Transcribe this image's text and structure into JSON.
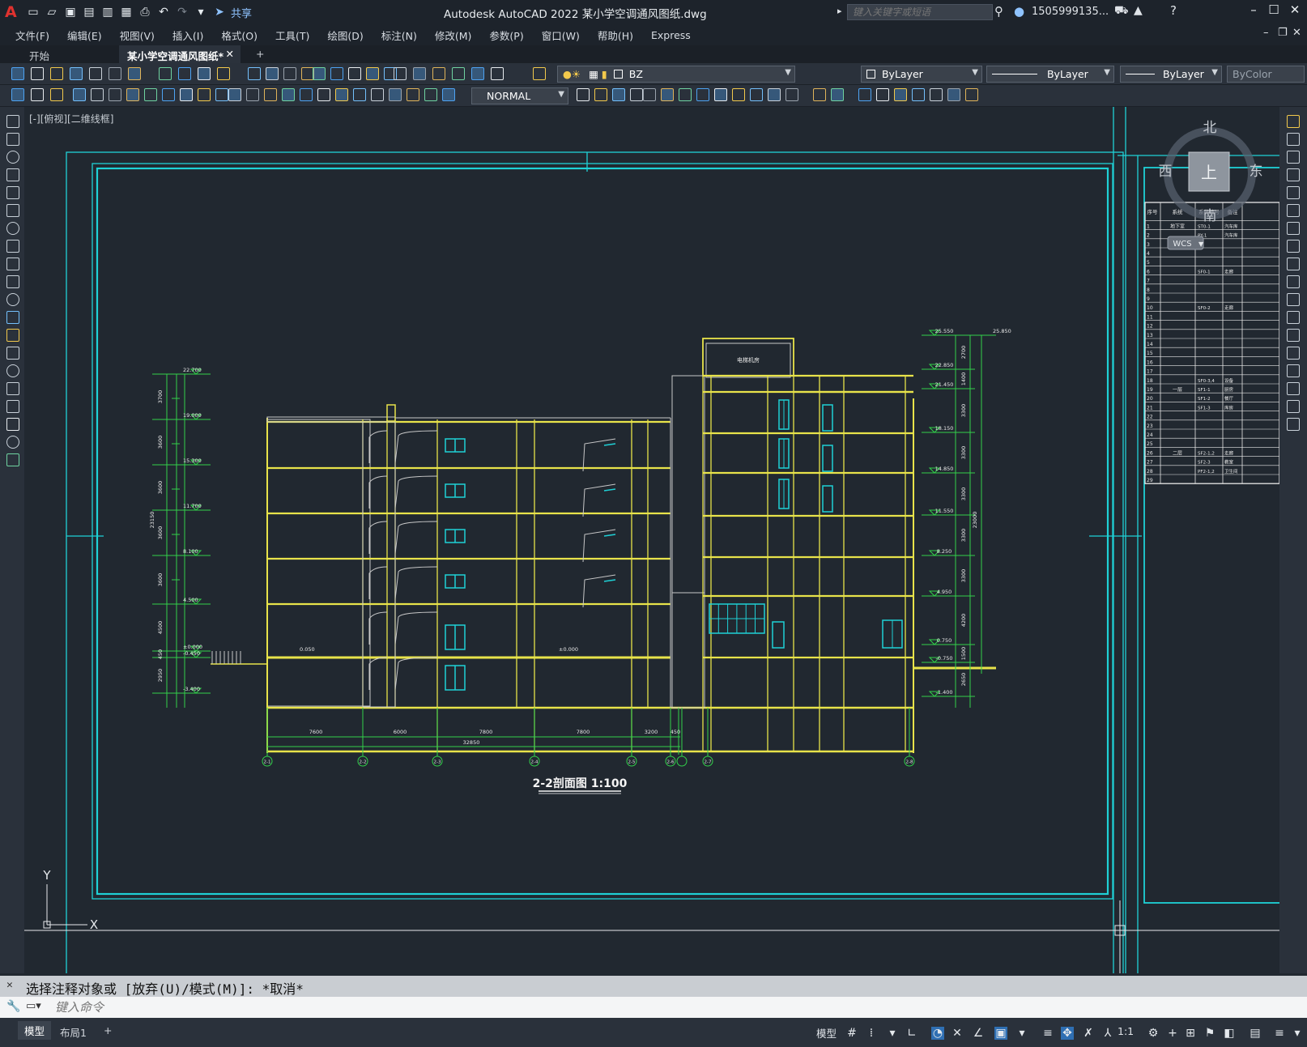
{
  "titlebar": {
    "app_letter": "A",
    "share_label": "共享",
    "window_title": "Autodesk AutoCAD 2022    某小学空调通风图纸.dwg",
    "search_placeholder": "键入关键字或短语",
    "user": "1505999135..."
  },
  "menu": [
    "文件(F)",
    "编辑(E)",
    "视图(V)",
    "插入(I)",
    "格式(O)",
    "工具(T)",
    "绘图(D)",
    "标注(N)",
    "修改(M)",
    "参数(P)",
    "窗口(W)",
    "帮助(H)",
    "Express"
  ],
  "tabs": {
    "start": "开始",
    "doc": "某小学空调通风图纸*",
    "add": "+"
  },
  "toolbar": {
    "layer": "BZ",
    "color": "ByLayer",
    "linetype": "ByLayer",
    "lineweight": "ByLayer",
    "plotstyle": "ByColor",
    "dimstyle": "NORMAL"
  },
  "viewport_label": "[-][俯视][二维线框]",
  "viewcube": {
    "north": "北",
    "south": "南",
    "east": "东",
    "west": "西",
    "top": "上",
    "wcs": "WCS"
  },
  "ucs": {
    "x": "X",
    "y": "Y"
  },
  "drawing": {
    "title": "2-2剖面图  1:100",
    "room_label": "电梯机房",
    "left_elevations": [
      "22.700",
      "19.000",
      "15.300",
      "11.700",
      "8.100",
      "4.500",
      "±0.000",
      "-0.450",
      "-3.400"
    ],
    "left_dims": [
      "3700",
      "3600",
      "3600",
      "3600",
      "3600",
      "4500",
      "450",
      "2950"
    ],
    "left_total": "23150",
    "right_elevations": [
      "25.550",
      "22.850",
      "21.450",
      "18.150",
      "14.850",
      "11.550",
      "8.250",
      "4.950",
      "0.750",
      "-0.750",
      "-1.400"
    ],
    "right_dims": [
      "2700",
      "1400",
      "3300",
      "3300",
      "3300",
      "3300",
      "3300",
      "4200",
      "1500",
      "2650"
    ],
    "right_total": "23000",
    "right_top": "25.850",
    "floor_marks": [
      "0.050",
      "±0.000"
    ],
    "bottom_dims": [
      "7600",
      "6000",
      "7800",
      "7800",
      "3200",
      "450"
    ],
    "bottom_total": "32850",
    "axes": [
      "2-1",
      "2-2",
      "2-3",
      "2-4",
      "2-5",
      "2-6",
      "2-7",
      "2-8"
    ]
  },
  "table": {
    "headers": [
      "序号",
      "系统",
      "系统编号",
      "备注"
    ],
    "rows": [
      {
        "n": "1",
        "sys": "地下室",
        "code": "ST0-1",
        "note": "汽车库"
      },
      {
        "n": "2",
        "sys": "",
        "code": "PY-1",
        "note": "汽车库"
      },
      {
        "n": "3",
        "sys": "",
        "code": "",
        "note": ""
      },
      {
        "n": "4",
        "sys": "",
        "code": "",
        "note": ""
      },
      {
        "n": "5",
        "sys": "",
        "code": "",
        "note": ""
      },
      {
        "n": "6",
        "sys": "",
        "code": "SF0-1",
        "note": "走廊"
      },
      {
        "n": "7",
        "sys": "",
        "code": "",
        "note": ""
      },
      {
        "n": "8",
        "sys": "",
        "code": "",
        "note": ""
      },
      {
        "n": "9",
        "sys": "",
        "code": "",
        "note": ""
      },
      {
        "n": "10",
        "sys": "",
        "code": "SF0-2",
        "note": "走廊"
      },
      {
        "n": "11",
        "sys": "",
        "code": "",
        "note": ""
      },
      {
        "n": "12",
        "sys": "",
        "code": "",
        "note": ""
      },
      {
        "n": "13",
        "sys": "",
        "code": "",
        "note": ""
      },
      {
        "n": "14",
        "sys": "",
        "code": "",
        "note": ""
      },
      {
        "n": "15",
        "sys": "",
        "code": "",
        "note": ""
      },
      {
        "n": "16",
        "sys": "",
        "code": "",
        "note": ""
      },
      {
        "n": "17",
        "sys": "",
        "code": "",
        "note": ""
      },
      {
        "n": "18",
        "sys": "",
        "code": "SF0-3,4",
        "note": "设备"
      },
      {
        "n": "19",
        "sys": "一层",
        "code": "SF1-1",
        "note": "厨房"
      },
      {
        "n": "20",
        "sys": "",
        "code": "SF1-2",
        "note": "餐厅"
      },
      {
        "n": "21",
        "sys": "",
        "code": "SF1-3",
        "note": "库房"
      },
      {
        "n": "22",
        "sys": "",
        "code": "",
        "note": ""
      },
      {
        "n": "23",
        "sys": "",
        "code": "",
        "note": ""
      },
      {
        "n": "24",
        "sys": "",
        "code": "",
        "note": ""
      },
      {
        "n": "25",
        "sys": "",
        "code": "",
        "note": ""
      },
      {
        "n": "26",
        "sys": "二层",
        "code": "SF2-1,2",
        "note": "走廊"
      },
      {
        "n": "27",
        "sys": "",
        "code": "SF2-3",
        "note": "教室"
      },
      {
        "n": "28",
        "sys": "",
        "code": "PF2-1,2",
        "note": "卫生间"
      },
      {
        "n": "29",
        "sys": "",
        "code": "",
        "note": ""
      }
    ]
  },
  "command": {
    "history": "选择注释对象或 [放弃(U)/模式(M)]: *取消*",
    "placeholder": "键入命令"
  },
  "status": {
    "model_tab": "模型",
    "layout_tab": "布局1",
    "add": "+",
    "model_btn": "模型",
    "scale": "1:1"
  }
}
